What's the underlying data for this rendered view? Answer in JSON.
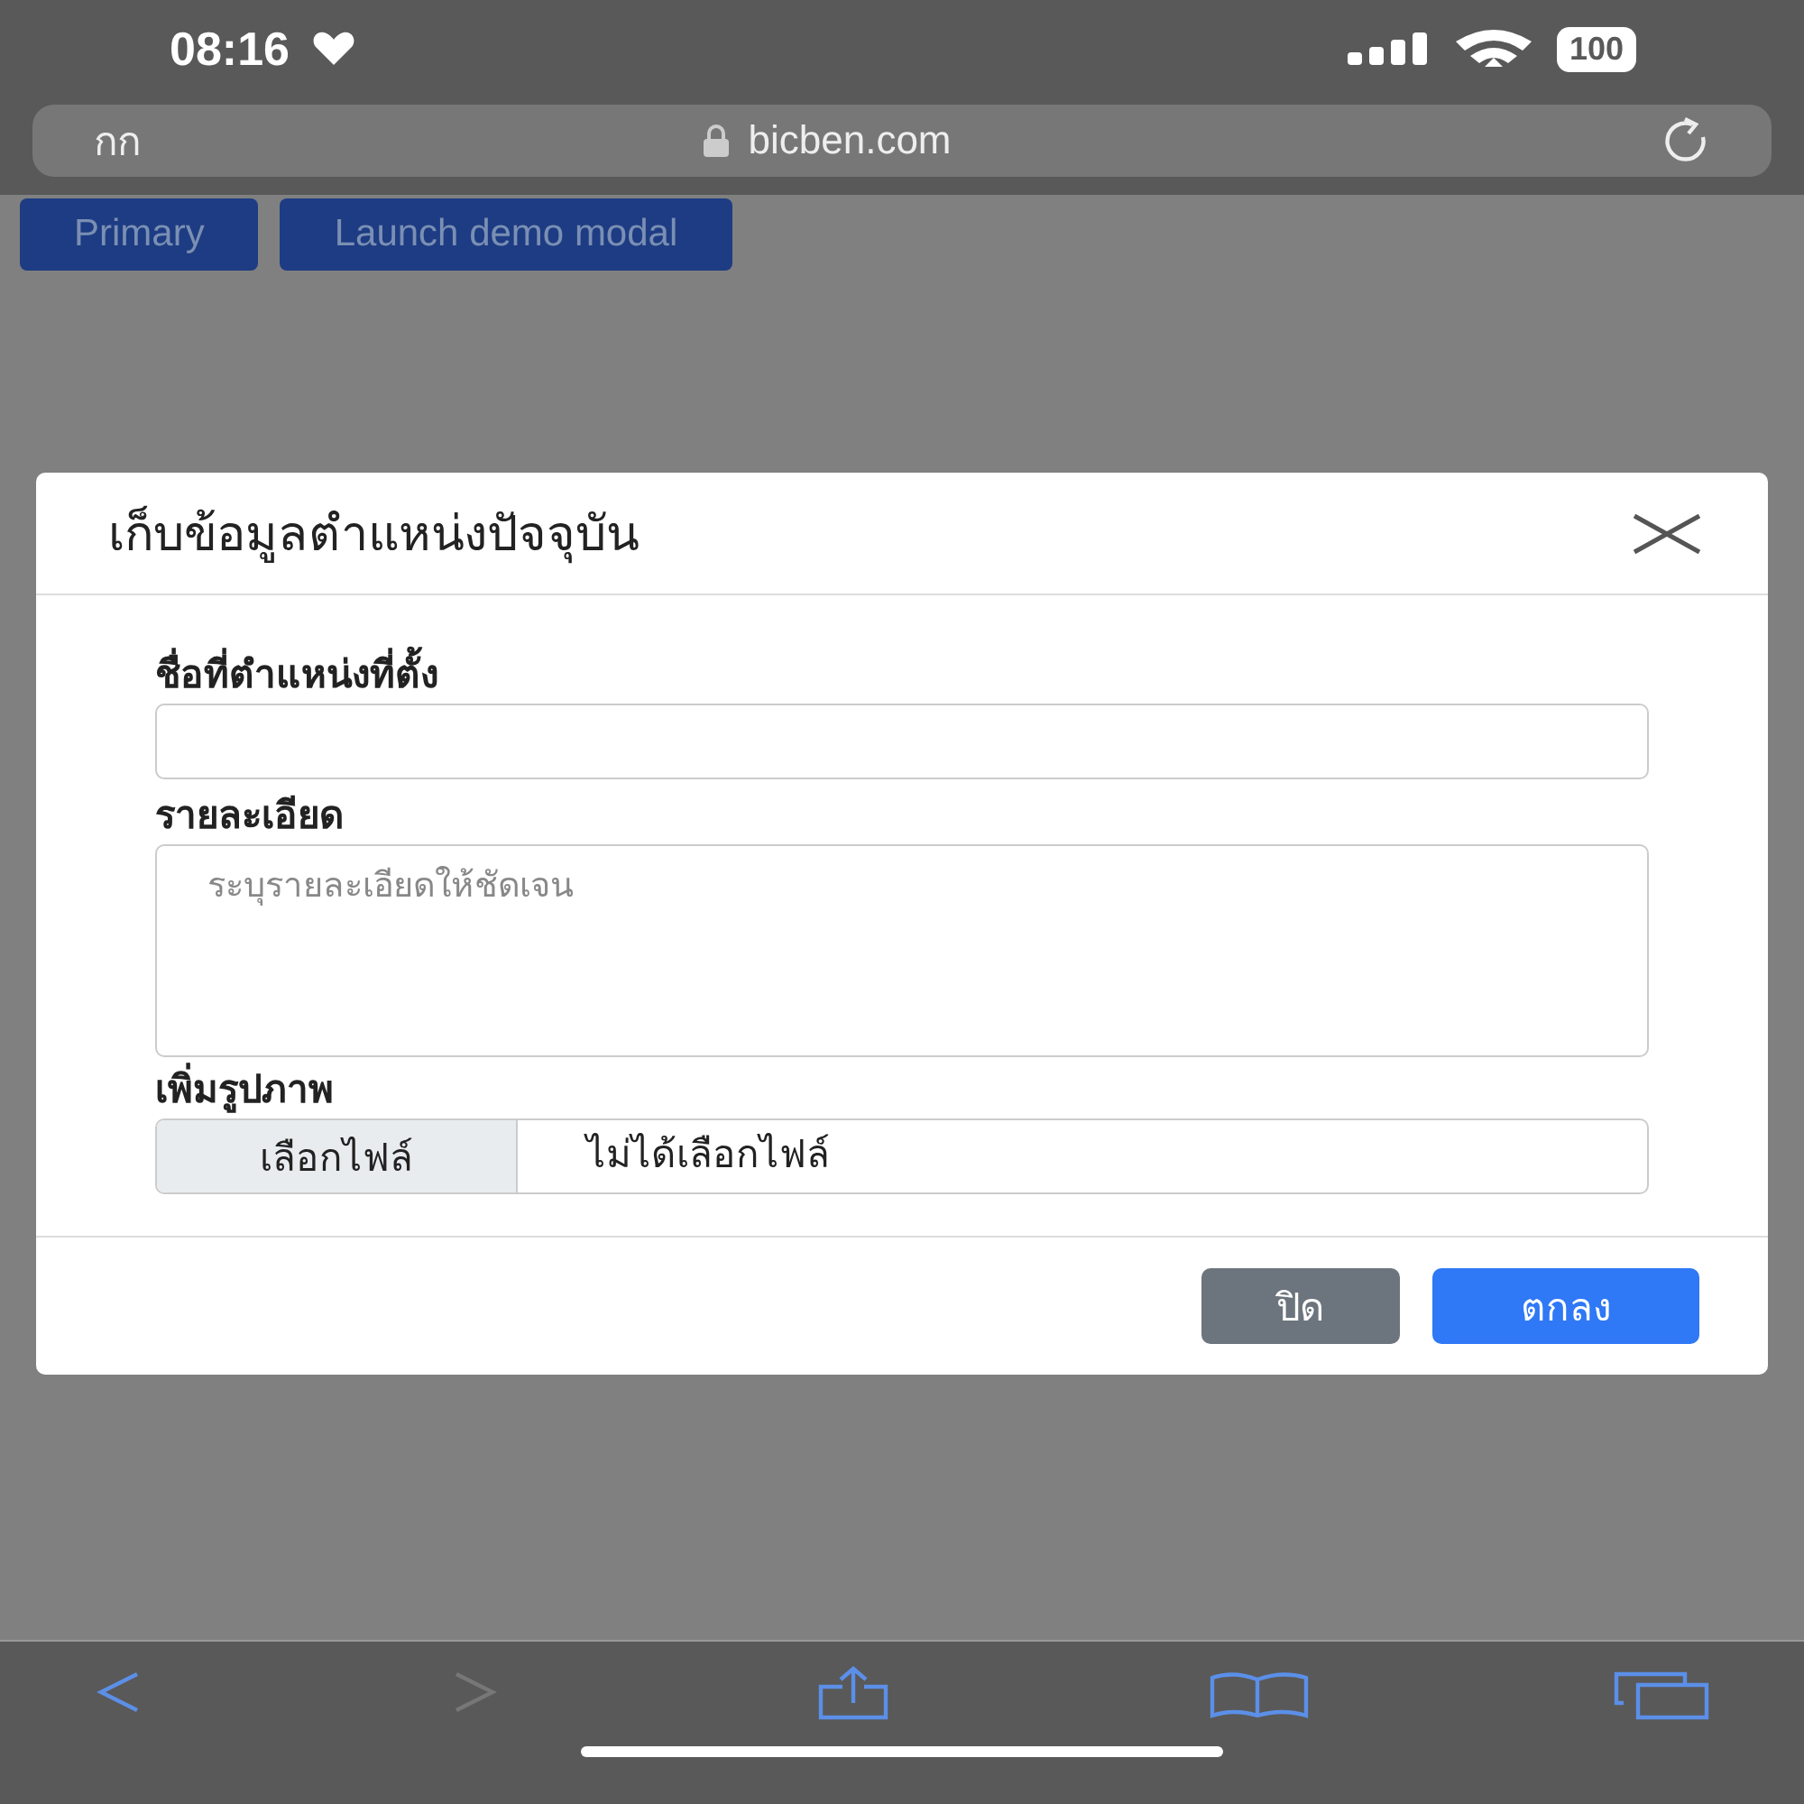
{
  "status_bar": {
    "time": "08:16",
    "battery": "100"
  },
  "address_bar": {
    "text_size": "กก",
    "url": "bicben.com"
  },
  "page_buttons": [
    {
      "label": "Primary"
    },
    {
      "label": "Launch demo modal"
    }
  ],
  "modal": {
    "title": "เก็บข้อมูลตำแหน่งปัจจุบัน",
    "fields": [
      {
        "kind": "input",
        "label": "ชื่อที่ตำแหน่งที่ตั้ง"
      },
      {
        "kind": "textarea",
        "label": "รายละเอียด",
        "placeholder": "ระบุรายละเอียดให้ชัดเจน"
      },
      {
        "kind": "file",
        "label": "เพิ่มรูปภาพ",
        "button": "เลือกไฟล์",
        "value": "ไม่ได้เลือกไฟล์"
      }
    ],
    "buttons": [
      {
        "kind": "secondary",
        "label": "ปิด"
      },
      {
        "kind": "primary",
        "label": "ตกลง"
      }
    ]
  },
  "toolbar": [
    {
      "kind": "back",
      "disabled": false
    },
    {
      "kind": "forward",
      "disabled": true
    },
    {
      "kind": "share",
      "disabled": false
    },
    {
      "kind": "bookmarks",
      "disabled": false
    },
    {
      "kind": "tabs",
      "disabled": false
    }
  ]
}
